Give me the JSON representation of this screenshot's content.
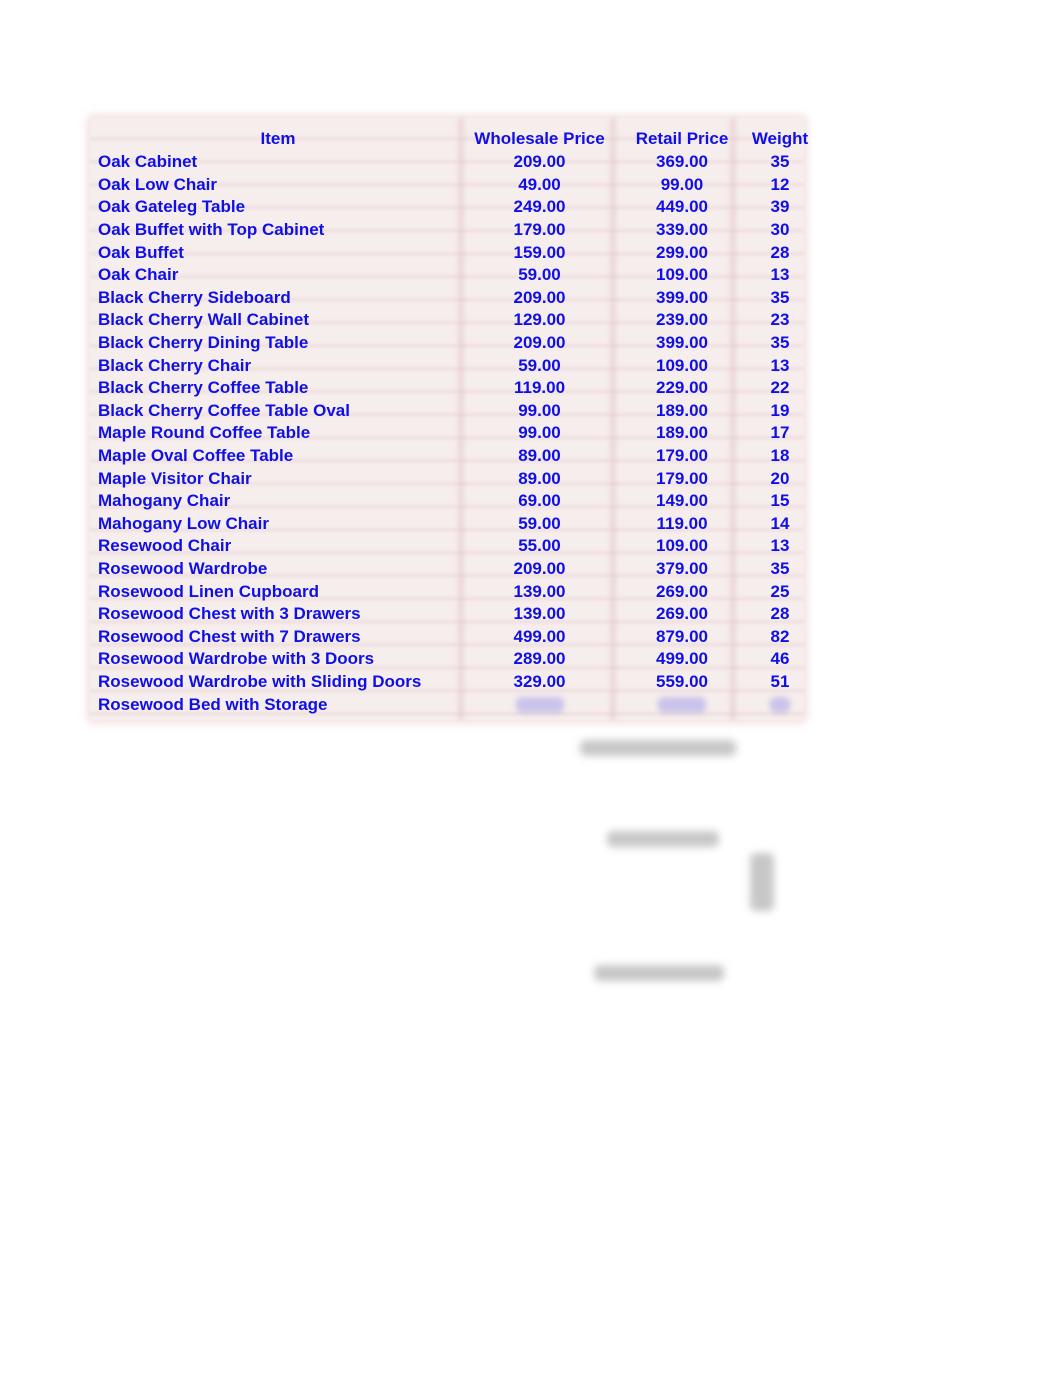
{
  "table": {
    "headers": {
      "item": "Item",
      "wholesale": "Wholesale Price",
      "retail": "Retail Price",
      "weight": "Weight"
    },
    "rows": [
      {
        "item": "Oak Cabinet",
        "wholesale": "209.00",
        "retail": "369.00",
        "weight": "35"
      },
      {
        "item": "Oak Low Chair",
        "wholesale": "49.00",
        "retail": "99.00",
        "weight": "12"
      },
      {
        "item": "Oak Gateleg Table",
        "wholesale": "249.00",
        "retail": "449.00",
        "weight": "39"
      },
      {
        "item": "Oak Buffet with Top Cabinet",
        "wholesale": "179.00",
        "retail": "339.00",
        "weight": "30"
      },
      {
        "item": "Oak Buffet",
        "wholesale": "159.00",
        "retail": "299.00",
        "weight": "28"
      },
      {
        "item": "Oak Chair",
        "wholesale": "59.00",
        "retail": "109.00",
        "weight": "13"
      },
      {
        "item": "Black Cherry Sideboard",
        "wholesale": "209.00",
        "retail": "399.00",
        "weight": "35"
      },
      {
        "item": "Black Cherry Wall Cabinet",
        "wholesale": "129.00",
        "retail": "239.00",
        "weight": "23"
      },
      {
        "item": "Black Cherry Dining Table",
        "wholesale": "209.00",
        "retail": "399.00",
        "weight": "35"
      },
      {
        "item": "Black Cherry Chair",
        "wholesale": "59.00",
        "retail": "109.00",
        "weight": "13"
      },
      {
        "item": "Black Cherry Coffee Table",
        "wholesale": "119.00",
        "retail": "229.00",
        "weight": "22"
      },
      {
        "item": "Black Cherry Coffee Table Oval",
        "wholesale": "99.00",
        "retail": "189.00",
        "weight": "19"
      },
      {
        "item": "Maple Round Coffee Table",
        "wholesale": "99.00",
        "retail": "189.00",
        "weight": "17"
      },
      {
        "item": "Maple Oval Coffee Table",
        "wholesale": "89.00",
        "retail": "179.00",
        "weight": "18"
      },
      {
        "item": "Maple Visitor Chair",
        "wholesale": "89.00",
        "retail": "179.00",
        "weight": "20"
      },
      {
        "item": "Mahogany Chair",
        "wholesale": "69.00",
        "retail": "149.00",
        "weight": "15"
      },
      {
        "item": "Mahogany Low Chair",
        "wholesale": "59.00",
        "retail": "119.00",
        "weight": "14"
      },
      {
        "item": "Resewood Chair",
        "wholesale": "55.00",
        "retail": "109.00",
        "weight": "13"
      },
      {
        "item": "Rosewood Wardrobe",
        "wholesale": "209.00",
        "retail": "379.00",
        "weight": "35"
      },
      {
        "item": "Rosewood Linen Cupboard",
        "wholesale": "139.00",
        "retail": "269.00",
        "weight": "25"
      },
      {
        "item": "Rosewood Chest with 3 Drawers",
        "wholesale": "139.00",
        "retail": "269.00",
        "weight": "28"
      },
      {
        "item": "Rosewood Chest with 7 Drawers",
        "wholesale": "499.00",
        "retail": "879.00",
        "weight": "82"
      },
      {
        "item": "Rosewood Wardrobe with 3 Doors",
        "wholesale": "289.00",
        "retail": "499.00",
        "weight": "46"
      },
      {
        "item": "Rosewood Wardrobe with Sliding Doors",
        "wholesale": "329.00",
        "retail": "559.00",
        "weight": "51"
      },
      {
        "item": "Rosewood Bed with Storage",
        "wholesale": null,
        "retail": null,
        "weight": null
      }
    ]
  },
  "colors": {
    "text": "#1010e6",
    "sheet_background": "#f6eded"
  }
}
